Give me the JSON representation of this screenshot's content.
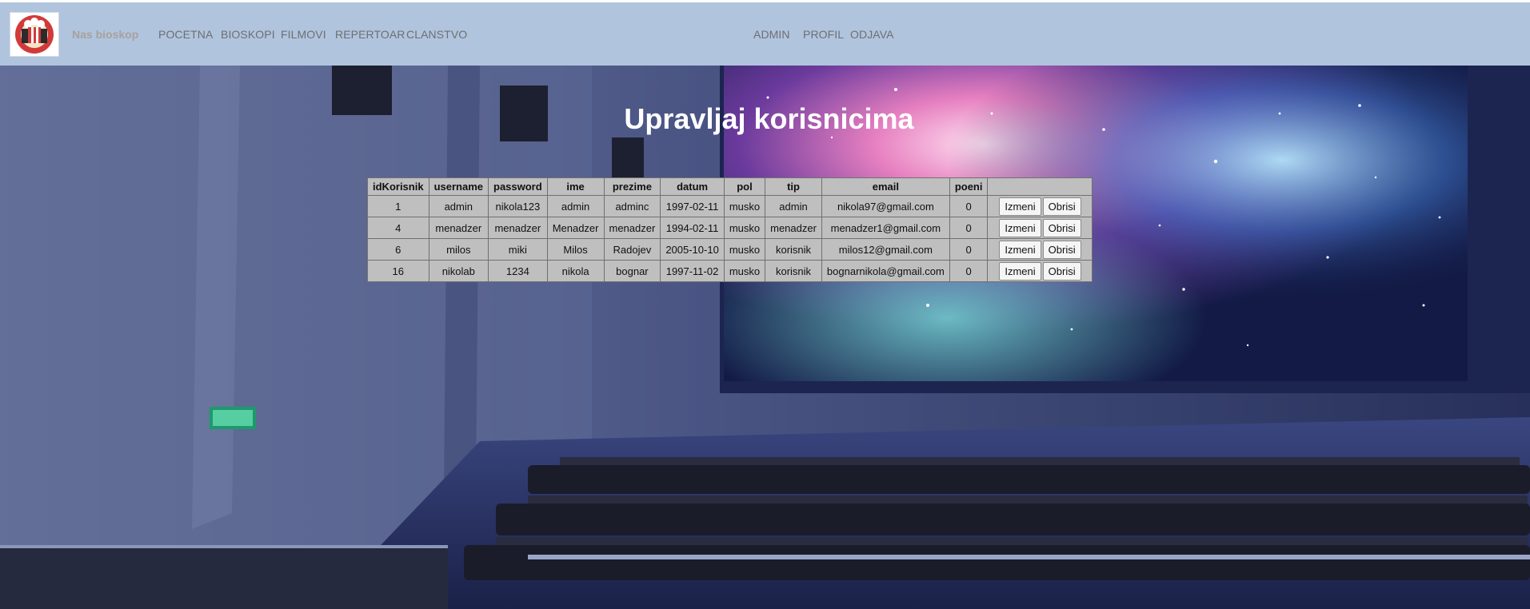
{
  "colors": {
    "navbar_bg": "#b0c4de",
    "table_bg": "#bfbfbf",
    "title_text": "#ffffff"
  },
  "navbar": {
    "brand": "Nas bioskop",
    "left_links": [
      "POCETNA",
      "BIOSKOPI",
      "FILMOVI",
      "REPERTOAR",
      "CLANSTVO"
    ],
    "right_links": [
      "ADMIN",
      "PROFIL",
      "ODJAVA"
    ]
  },
  "main": {
    "title": "Upravljaj korisnicima",
    "table": {
      "headers": [
        "idKorisnik",
        "username",
        "password",
        "ime",
        "prezime",
        "datum",
        "pol",
        "tip",
        "email",
        "poeni"
      ],
      "edit_label": "Izmeni",
      "delete_label": "Obrisi",
      "rows": [
        [
          "1",
          "admin",
          "nikola123",
          "admin",
          "adminc",
          "1997-02-11",
          "musko",
          "admin",
          "nikola97@gmail.com",
          "0"
        ],
        [
          "4",
          "menadzer",
          "menadzer",
          "Menadzer",
          "menadzer",
          "1994-02-11",
          "musko",
          "menadzer",
          "menadzer1@gmail.com",
          "0"
        ],
        [
          "6",
          "milos",
          "miki",
          "Milos",
          "Radojev",
          "2005-10-10",
          "musko",
          "korisnik",
          "milos12@gmail.com",
          "0"
        ],
        [
          "16",
          "nikolab",
          "1234",
          "nikola",
          "bognar",
          "1997-11-02",
          "musko",
          "korisnik",
          "bognarnikola@gmail.com",
          "0"
        ]
      ]
    }
  }
}
